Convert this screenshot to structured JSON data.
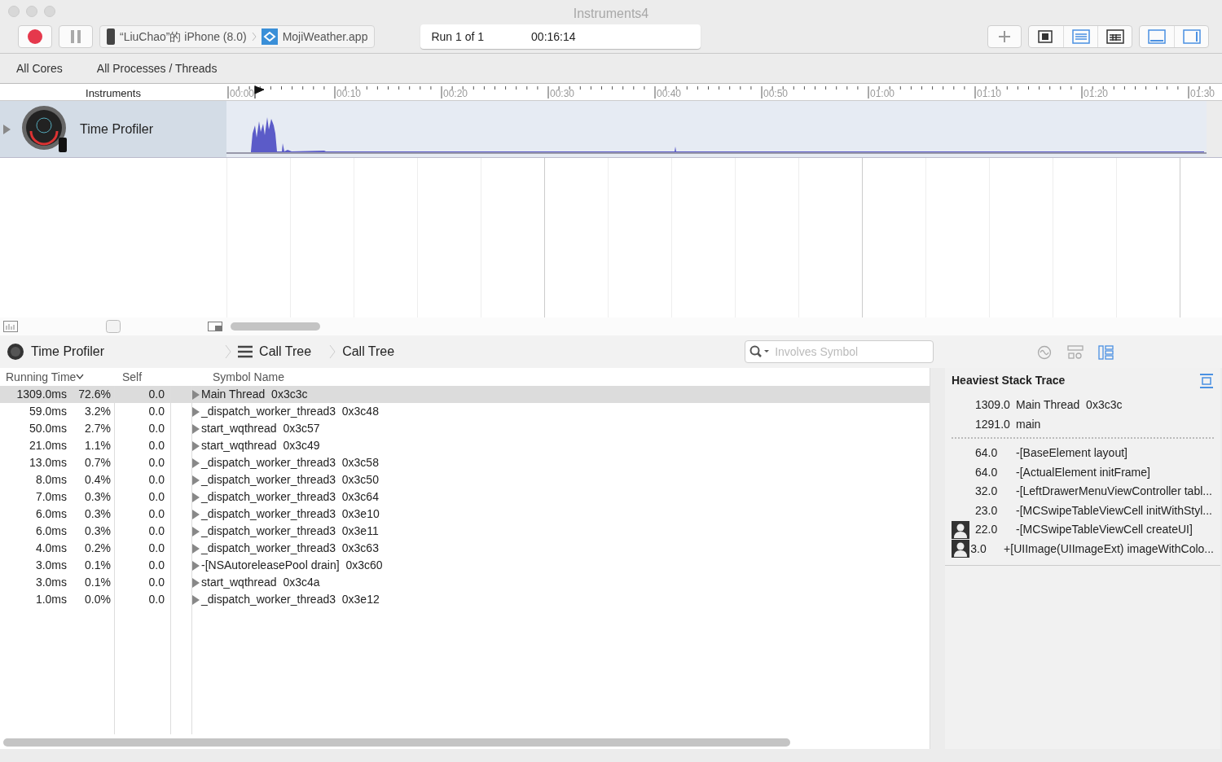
{
  "window": {
    "title": "Instruments4"
  },
  "toolbar": {
    "target_device": "“LiuChao”的 iPhone (8.0)",
    "target_app": "MojiWeather.app",
    "run": "Run 1 of 1",
    "elapsed": "00:16:14",
    "toggles": [
      {
        "kind": "cpu",
        "selected": false
      },
      {
        "kind": "list",
        "selected": true
      },
      {
        "kind": "grid",
        "selected": false
      }
    ],
    "panels": [
      {
        "kind": "bottom",
        "selected": true
      },
      {
        "kind": "right",
        "selected": true
      }
    ]
  },
  "filter_bar": [
    "All Cores",
    "All Processes / Threads"
  ],
  "timeline": {
    "header": "Instruments",
    "ticks": [
      "00:00",
      "00:10",
      "00:20",
      "00:30",
      "00:40",
      "00:50",
      "01:00",
      "01:10",
      "01:20",
      "01:30"
    ],
    "tracks": [
      {
        "name": "Time Profiler",
        "selected": true
      }
    ]
  },
  "detail": {
    "breadcrumb": [
      "Time Profiler",
      "Call Tree",
      "Call Tree"
    ],
    "search": {
      "placeholder": "Involves Symbol"
    },
    "inspector_tabs": [
      {
        "kind": "recording",
        "selected": false
      },
      {
        "kind": "display",
        "selected": false
      },
      {
        "kind": "stack",
        "selected": true
      }
    ]
  },
  "call_tree": {
    "columns": [
      "Running Time",
      "Self",
      "Symbol Name"
    ],
    "rows": [
      {
        "running_time": "1309.0ms",
        "percent": "72.6%",
        "self": "0.0",
        "symbol": "Main Thread  0x3c3c",
        "selected": true
      },
      {
        "running_time": "59.0ms",
        "percent": "3.2%",
        "self": "0.0",
        "symbol": "_dispatch_worker_thread3  0x3c48",
        "selected": false
      },
      {
        "running_time": "50.0ms",
        "percent": "2.7%",
        "self": "0.0",
        "symbol": "start_wqthread  0x3c57",
        "selected": false
      },
      {
        "running_time": "21.0ms",
        "percent": "1.1%",
        "self": "0.0",
        "symbol": "start_wqthread  0x3c49",
        "selected": false
      },
      {
        "running_time": "13.0ms",
        "percent": "0.7%",
        "self": "0.0",
        "symbol": "_dispatch_worker_thread3  0x3c58",
        "selected": false
      },
      {
        "running_time": "8.0ms",
        "percent": "0.4%",
        "self": "0.0",
        "symbol": "_dispatch_worker_thread3  0x3c50",
        "selected": false
      },
      {
        "running_time": "7.0ms",
        "percent": "0.3%",
        "self": "0.0",
        "symbol": "_dispatch_worker_thread3  0x3c64",
        "selected": false
      },
      {
        "running_time": "6.0ms",
        "percent": "0.3%",
        "self": "0.0",
        "symbol": "_dispatch_worker_thread3  0x3e10",
        "selected": false
      },
      {
        "running_time": "6.0ms",
        "percent": "0.3%",
        "self": "0.0",
        "symbol": "_dispatch_worker_thread3  0x3e11",
        "selected": false
      },
      {
        "running_time": "4.0ms",
        "percent": "0.2%",
        "self": "0.0",
        "symbol": "_dispatch_worker_thread3  0x3c63",
        "selected": false
      },
      {
        "running_time": "3.0ms",
        "percent": "0.1%",
        "self": "0.0",
        "symbol": "-[NSAutoreleasePool drain]  0x3c60",
        "selected": false
      },
      {
        "running_time": "3.0ms",
        "percent": "0.1%",
        "self": "0.0",
        "symbol": "start_wqthread  0x3c4a",
        "selected": false
      },
      {
        "running_time": "1.0ms",
        "percent": "0.0%",
        "self": "0.0",
        "symbol": "_dispatch_worker_thread3  0x3e12",
        "selected": false
      }
    ]
  },
  "heaviest_stack_trace": {
    "title": "Heaviest Stack Trace",
    "threads": [
      {
        "weight": "1309.0",
        "symbol": "Main Thread  0x3c3c"
      },
      {
        "weight": "1291.0",
        "symbol": "main"
      }
    ],
    "frames": [
      {
        "weight": "64.0",
        "symbol": "-[BaseElement layout]",
        "kind": "system"
      },
      {
        "weight": "64.0",
        "symbol": "-[ActualElement initFrame]",
        "kind": "system"
      },
      {
        "weight": "32.0",
        "symbol": "-[LeftDrawerMenuViewController tabl...",
        "kind": "system"
      },
      {
        "weight": "23.0",
        "symbol": "-[MCSwipeTableViewCell initWithStyl...",
        "kind": "system"
      },
      {
        "weight": "22.0",
        "symbol": "-[MCSwipeTableViewCell createUI]",
        "kind": "user"
      },
      {
        "weight": "3.0",
        "symbol": "+[UIImage(UIImageExt) imageWithColo...",
        "kind": "user"
      }
    ]
  }
}
